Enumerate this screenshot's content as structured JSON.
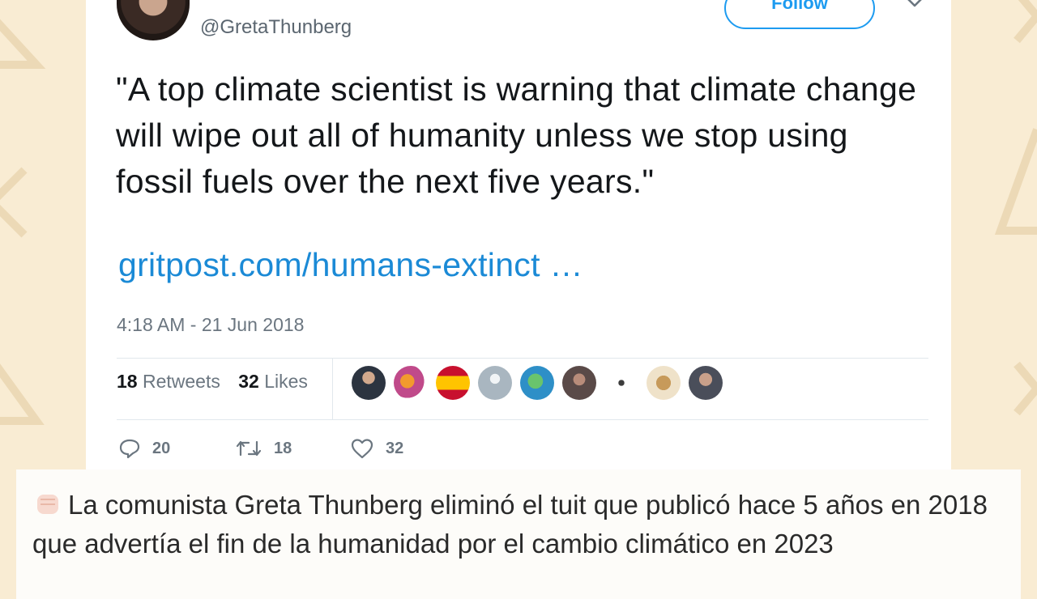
{
  "tweet": {
    "handle": "@GretaThunberg",
    "follow_label": "Follow",
    "text": "\"A top climate scientist is warning that climate change will wipe out all of humanity unless we stop using fossil fuels over the next five years.\"",
    "link": "gritpost.com/humans-extinct …",
    "timestamp": "4:18 AM - 21 Jun 2018",
    "retweets_count": "18",
    "retweets_label": "Retweets",
    "likes_count": "32",
    "likes_label": "Likes",
    "actions": {
      "replies": "20",
      "retweets": "18",
      "likes": "32"
    }
  },
  "caption": {
    "text": "La comunista Greta Thunberg eliminó el tuit que publicó hace 5 años en 2018 que advertía el fin de la humanidad por el cambio climático en 2023"
  },
  "colors": {
    "background": "#f9ecd3",
    "link": "#1b8ad6",
    "follow": "#1d9bf0"
  },
  "icons": [
    "chevron-down-icon",
    "reply-icon",
    "retweet-icon",
    "heart-icon",
    "raised-fist-emoji"
  ]
}
